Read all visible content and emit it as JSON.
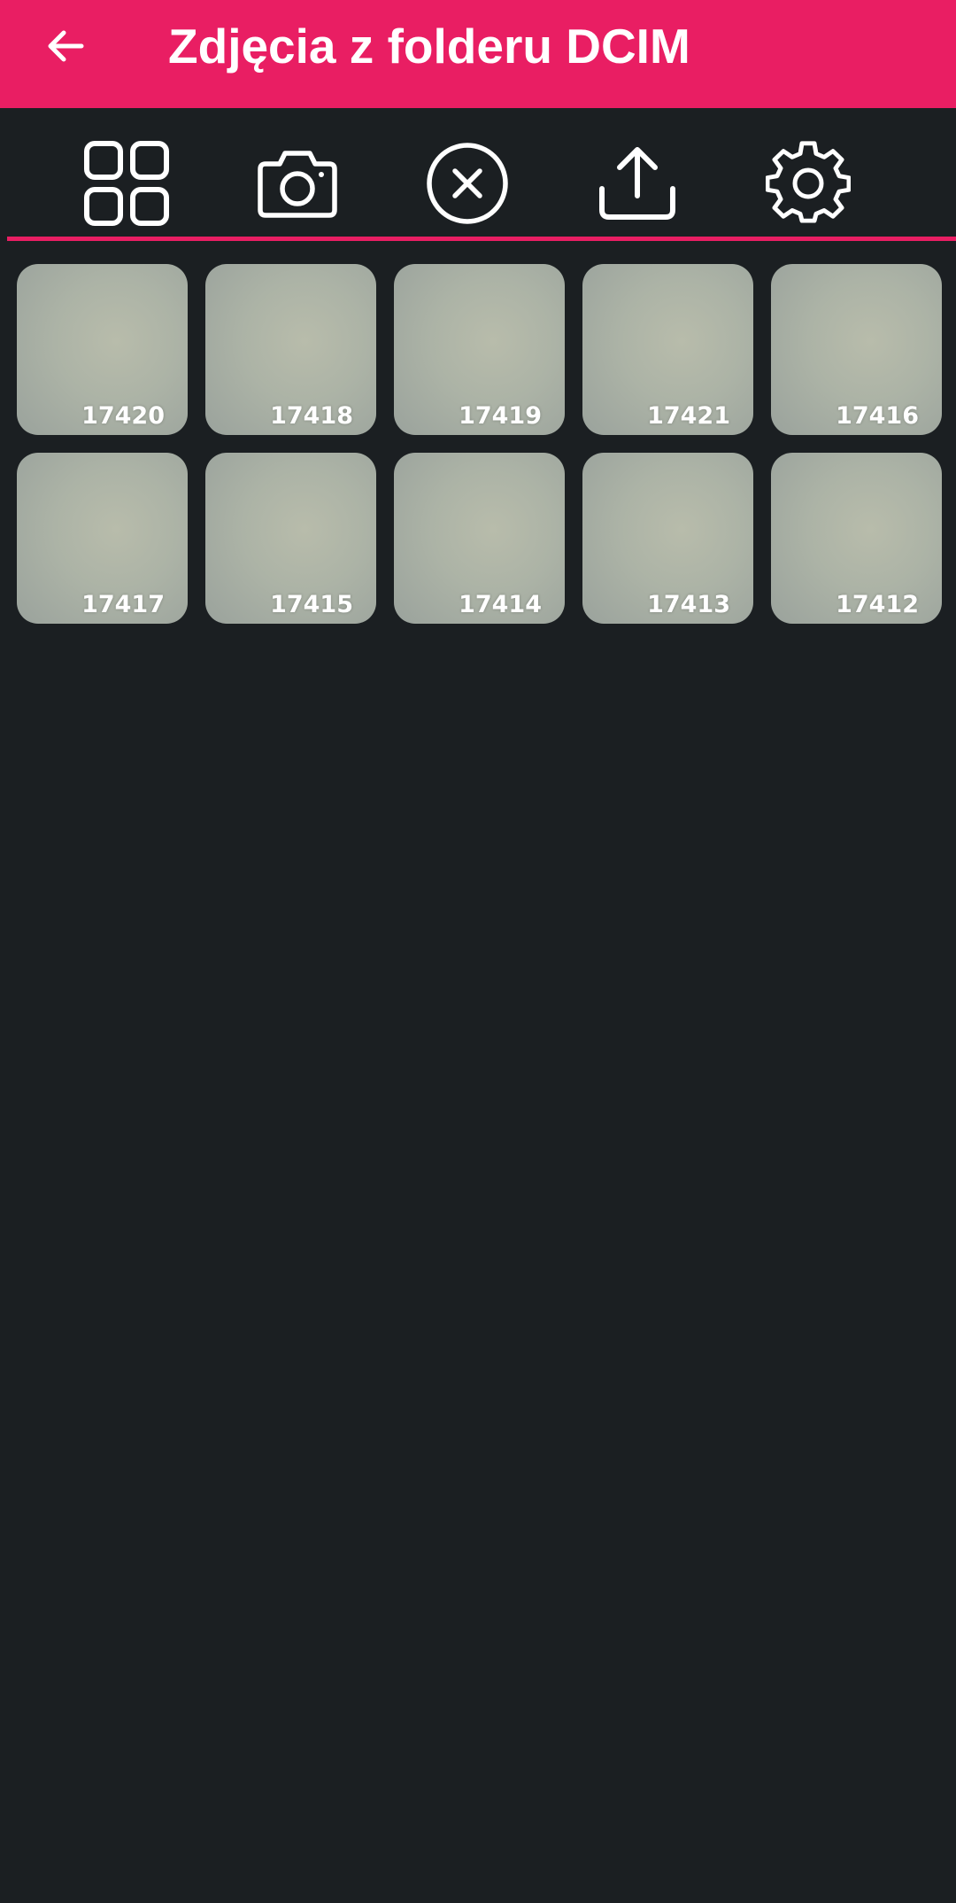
{
  "appbar": {
    "title": "Zdjęcia z folderu DCIM",
    "back_icon": "arrow-left-icon",
    "color": "#e91e63"
  },
  "toolbar": {
    "items": [
      {
        "name": "grid-view",
        "icon": "grid-icon"
      },
      {
        "name": "camera",
        "icon": "camera-icon"
      },
      {
        "name": "clear-selection",
        "icon": "close-circle-icon"
      },
      {
        "name": "upload",
        "icon": "upload-icon"
      },
      {
        "name": "settings",
        "icon": "gear-icon"
      }
    ]
  },
  "photos": [
    {
      "label": "17420"
    },
    {
      "label": "17418"
    },
    {
      "label": "17419"
    },
    {
      "label": "17421"
    },
    {
      "label": "17416"
    },
    {
      "label": "17417"
    },
    {
      "label": "17415"
    },
    {
      "label": "17414"
    },
    {
      "label": "17413"
    },
    {
      "label": "17412"
    }
  ],
  "colors": {
    "background": "#1b1f22",
    "accent": "#e91e63"
  }
}
